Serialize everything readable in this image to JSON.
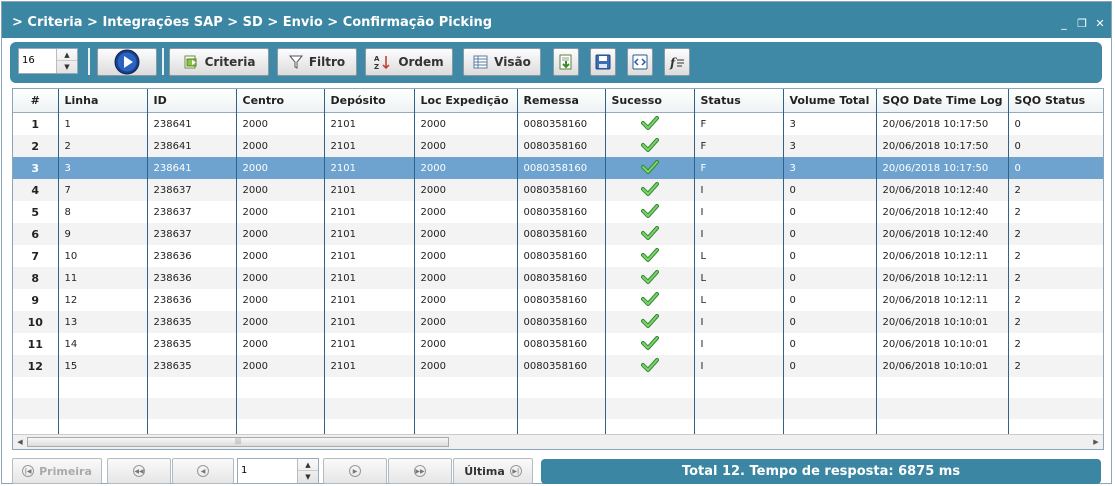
{
  "window": {
    "breadcrumb": "> Criteria > Integrações SAP > SD > Envio > Confirmação Picking",
    "controls": {
      "minimize": "_",
      "restore": "❐",
      "close": "✕"
    }
  },
  "toolbar": {
    "page_size": "16",
    "criteria_label": "Criteria",
    "filtro_label": "Filtro",
    "ordem_label": "Ordem",
    "visao_label": "Visão"
  },
  "table": {
    "columns": [
      "#",
      "Linha",
      "ID",
      "Centro",
      "Depósito",
      "Loc Expedição",
      "Remessa",
      "Sucesso",
      "Status",
      "Volume Total",
      "SQO Date Time Log",
      "SQO Status"
    ],
    "rows": [
      {
        "n": "1",
        "linha": "1",
        "id": "238641",
        "centro": "2000",
        "deposito": "2101",
        "loc": "2000",
        "remessa": "0080358160",
        "status": "F",
        "volume": "3",
        "datetime": "20/06/2018 10:17:50",
        "sqo": "0"
      },
      {
        "n": "2",
        "linha": "2",
        "id": "238641",
        "centro": "2000",
        "deposito": "2101",
        "loc": "2000",
        "remessa": "0080358160",
        "status": "F",
        "volume": "3",
        "datetime": "20/06/2018 10:17:50",
        "sqo": "0"
      },
      {
        "n": "3",
        "linha": "3",
        "id": "238641",
        "centro": "2000",
        "deposito": "2101",
        "loc": "2000",
        "remessa": "0080358160",
        "status": "F",
        "volume": "3",
        "datetime": "20/06/2018 10:17:50",
        "sqo": "0"
      },
      {
        "n": "4",
        "linha": "7",
        "id": "238637",
        "centro": "2000",
        "deposito": "2101",
        "loc": "2000",
        "remessa": "0080358160",
        "status": "I",
        "volume": "0",
        "datetime": "20/06/2018 10:12:40",
        "sqo": "2"
      },
      {
        "n": "5",
        "linha": "8",
        "id": "238637",
        "centro": "2000",
        "deposito": "2101",
        "loc": "2000",
        "remessa": "0080358160",
        "status": "I",
        "volume": "0",
        "datetime": "20/06/2018 10:12:40",
        "sqo": "2"
      },
      {
        "n": "6",
        "linha": "9",
        "id": "238637",
        "centro": "2000",
        "deposito": "2101",
        "loc": "2000",
        "remessa": "0080358160",
        "status": "I",
        "volume": "0",
        "datetime": "20/06/2018 10:12:40",
        "sqo": "2"
      },
      {
        "n": "7",
        "linha": "10",
        "id": "238636",
        "centro": "2000",
        "deposito": "2101",
        "loc": "2000",
        "remessa": "0080358160",
        "status": "L",
        "volume": "0",
        "datetime": "20/06/2018 10:12:11",
        "sqo": "2"
      },
      {
        "n": "8",
        "linha": "11",
        "id": "238636",
        "centro": "2000",
        "deposito": "2101",
        "loc": "2000",
        "remessa": "0080358160",
        "status": "L",
        "volume": "0",
        "datetime": "20/06/2018 10:12:11",
        "sqo": "2"
      },
      {
        "n": "9",
        "linha": "12",
        "id": "238636",
        "centro": "2000",
        "deposito": "2101",
        "loc": "2000",
        "remessa": "0080358160",
        "status": "L",
        "volume": "0",
        "datetime": "20/06/2018 10:12:11",
        "sqo": "2"
      },
      {
        "n": "10",
        "linha": "13",
        "id": "238635",
        "centro": "2000",
        "deposito": "2101",
        "loc": "2000",
        "remessa": "0080358160",
        "status": "I",
        "volume": "0",
        "datetime": "20/06/2018 10:10:01",
        "sqo": "2"
      },
      {
        "n": "11",
        "linha": "14",
        "id": "238635",
        "centro": "2000",
        "deposito": "2101",
        "loc": "2000",
        "remessa": "0080358160",
        "status": "I",
        "volume": "0",
        "datetime": "20/06/2018 10:10:01",
        "sqo": "2"
      },
      {
        "n": "12",
        "linha": "15",
        "id": "238635",
        "centro": "2000",
        "deposito": "2101",
        "loc": "2000",
        "remessa": "0080358160",
        "status": "I",
        "volume": "0",
        "datetime": "20/06/2018 10:10:01",
        "sqo": "2"
      }
    ],
    "success_icon": "check-icon",
    "selected_row": 3
  },
  "pager": {
    "first_label": "Primeira",
    "last_label": "Última",
    "page_value": "1"
  },
  "status_bar": {
    "text": "Total 12. Tempo de resposta: 6875 ms"
  },
  "colors": {
    "header_blue": "#3b86a3",
    "selection": "#6fa3cf",
    "check_green": "#4fb34a"
  }
}
